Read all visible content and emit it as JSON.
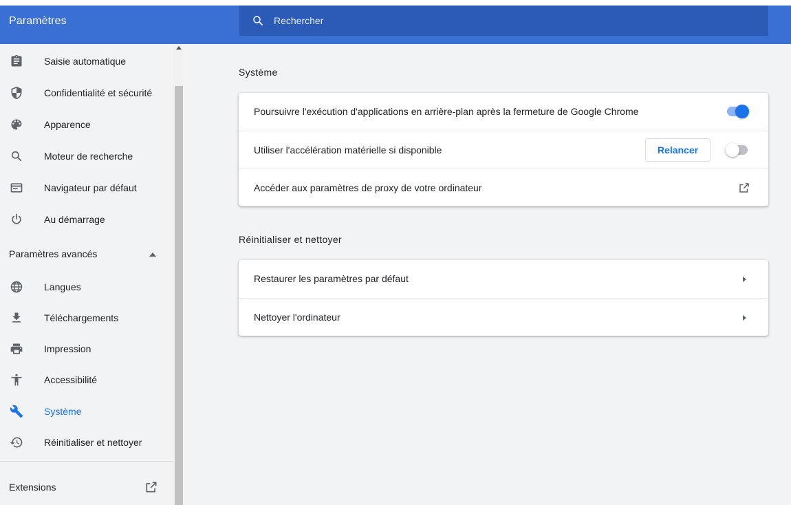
{
  "header": {
    "title": "Paramètres",
    "search_placeholder": "Rechercher",
    "search_icon": "search-icon"
  },
  "sidebar": {
    "items": [
      {
        "label": "Saisie automatique",
        "icon": "clipboard-icon"
      },
      {
        "label": "Confidentialité et sécurité",
        "icon": "shield-icon"
      },
      {
        "label": "Apparence",
        "icon": "palette-icon"
      },
      {
        "label": "Moteur de recherche",
        "icon": "search-icon"
      },
      {
        "label": "Navigateur par défaut",
        "icon": "browser-window-icon"
      },
      {
        "label": "Au démarrage",
        "icon": "power-icon"
      }
    ],
    "advanced_label": "Paramètres avancés",
    "advanced_items": [
      {
        "label": "Langues",
        "icon": "globe-icon"
      },
      {
        "label": "Téléchargements",
        "icon": "download-icon"
      },
      {
        "label": "Impression",
        "icon": "printer-icon"
      },
      {
        "label": "Accessibilité",
        "icon": "accessibility-icon"
      },
      {
        "label": "Système",
        "icon": "wrench-icon",
        "active": true
      },
      {
        "label": "Réinitialiser et nettoyer",
        "icon": "restore-icon"
      }
    ],
    "extensions_label": "Extensions"
  },
  "main": {
    "system": {
      "title": "Système",
      "rows": [
        {
          "label": "Poursuivre l'exécution d'applications en arrière-plan après la fermeture de Google Chrome",
          "control": "toggle",
          "enabled": true
        },
        {
          "label": "Utiliser l'accélération matérielle si disponible",
          "control": "toggle",
          "enabled": false,
          "button_label": "Relancer"
        },
        {
          "label": "Accéder aux paramètres de proxy de votre ordinateur",
          "control": "external-link"
        }
      ]
    },
    "reset": {
      "title": "Réinitialiser et nettoyer",
      "rows": [
        {
          "label": "Restaurer les paramètres par défaut",
          "control": "chevron"
        },
        {
          "label": "Nettoyer l'ordinateur",
          "control": "chevron"
        }
      ]
    }
  },
  "colors": {
    "header": "#3a6fd3",
    "search_bg": "#2c5bb7",
    "accent": "#1a73e8",
    "sidebar_bg": "#f1f3f4"
  }
}
